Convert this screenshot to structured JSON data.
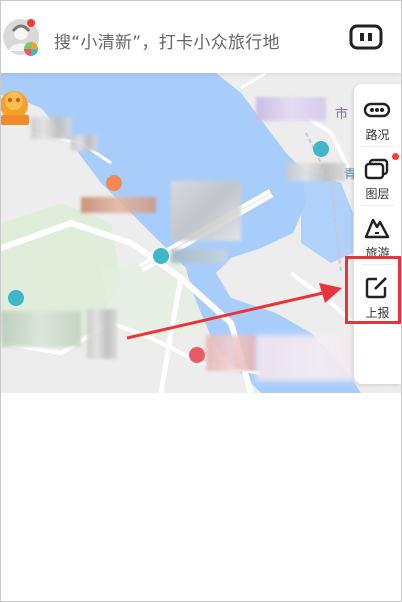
{
  "search": {
    "placeholder": "搜“小清新”，打卡小众旅行地"
  },
  "toolbar": {
    "items": [
      {
        "label": "路况",
        "icon": "traffic-icon"
      },
      {
        "label": "图层",
        "icon": "layers-icon",
        "badge": true
      },
      {
        "label": "旅游",
        "icon": "tourism-icon"
      },
      {
        "label": "上报",
        "icon": "report-icon",
        "highlighted": true
      }
    ]
  },
  "map": {
    "labels": {
      "top_right": "市",
      "side_char": "青"
    }
  },
  "colors": {
    "water": "#a9cdfb",
    "land": "#ededed",
    "road": "#ffffff",
    "highlight": "#e8343a",
    "badge": "#ff3b30"
  }
}
